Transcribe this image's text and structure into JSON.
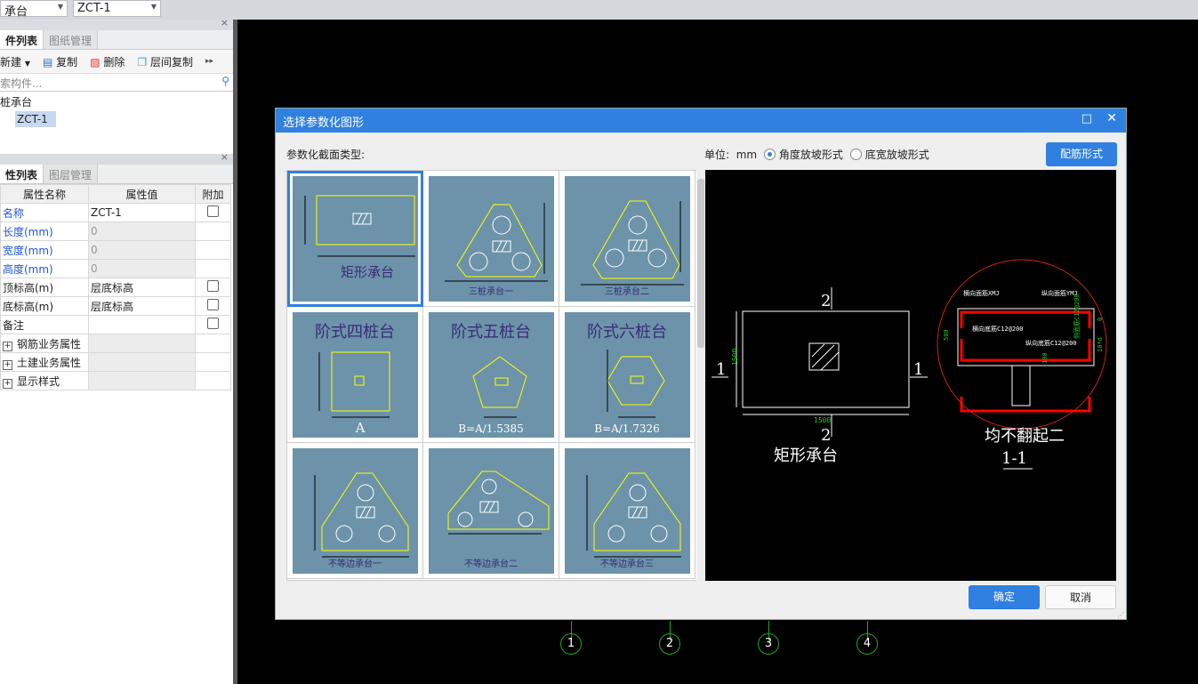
{
  "topbar": {
    "type_select": "承台",
    "component_select": "ZCT-1"
  },
  "component_panel": {
    "tabs": [
      "件列表",
      "图纸管理"
    ],
    "toolbar": {
      "new": "新建",
      "copy": "复制",
      "delete": "删除",
      "floor_copy": "层间复制"
    },
    "search_placeholder": "索构件...",
    "tree": {
      "group": "桩承台",
      "item": "ZCT-1"
    }
  },
  "property_panel": {
    "tabs": [
      "性列表",
      "图层管理"
    ],
    "headers": [
      "属性名称",
      "属性值",
      "附加"
    ],
    "rows": [
      {
        "name": "名称",
        "value": "ZCT-1"
      },
      {
        "name": "长度(mm)",
        "value": "0"
      },
      {
        "name": "宽度(mm)",
        "value": "0"
      },
      {
        "name": "高度(mm)",
        "value": "0"
      },
      {
        "name": "顶标高(m)",
        "value": "层底标高"
      },
      {
        "name": "底标高(m)",
        "value": "层底标高"
      },
      {
        "name": "备注",
        "value": ""
      },
      {
        "name": "钢筋业务属性",
        "value": ""
      },
      {
        "name": "土建业务属性",
        "value": ""
      },
      {
        "name": "显示样式",
        "value": ""
      }
    ]
  },
  "dialog": {
    "title": "选择参数化图形",
    "section_label": "参数化截面类型:",
    "unit_label": "单位:",
    "unit": "mm",
    "radio_angle": "角度放坡形式",
    "radio_width": "底宽放坡形式",
    "rebar_button": "配筋形式",
    "ok": "确定",
    "cancel": "取消",
    "shapes": [
      {
        "label": "矩形承台"
      },
      {
        "label": "三桩承台一"
      },
      {
        "label": "三桩承台二"
      },
      {
        "label": "阶式四桩台",
        "note": "A"
      },
      {
        "label": "阶式五桩台",
        "note": "B=A/1.5385"
      },
      {
        "label": "阶式六桩台",
        "note": "B=A/1.7326"
      },
      {
        "label": "不等边承台一"
      },
      {
        "label": "不等边承台二"
      },
      {
        "label": "不等边承台三"
      }
    ],
    "preview": {
      "plan_title": "矩形承台",
      "dim_w": "1500",
      "dim_h": "1500",
      "sec1": "1",
      "sec2": "2",
      "section_title": "1-1",
      "note": "均不翻起二",
      "top_x": "横向面筋XMJ",
      "top_y": "纵向面筋YMJ",
      "bot_x": "横向底筋C12@200",
      "bot_y": "纵向底筋C12@200",
      "side": "侧面筋C12@200",
      "height": "500",
      "cover": "100",
      "d10": "10*d",
      "zero": "0"
    }
  },
  "axes": [
    "1",
    "2",
    "3",
    "4"
  ],
  "colors": {
    "accent": "#2f80e0",
    "thumb_bg": "#6c93a9",
    "cad_green": "#22cc22"
  }
}
